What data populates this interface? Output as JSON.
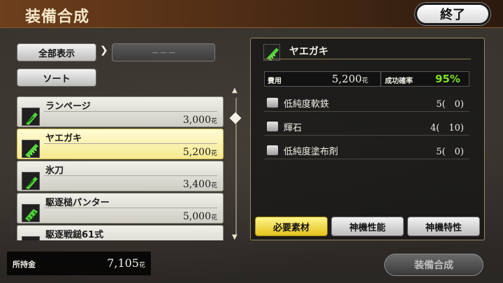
{
  "header": {
    "title": "装備合成",
    "end_label": "終了"
  },
  "controls": {
    "show_all_label": "全部表示",
    "filter_arrow": "❯",
    "filter_value": "－－－",
    "sort_label": "ソート"
  },
  "list": {
    "items": [
      {
        "name": "ランページ",
        "price": "3,000",
        "currency": "花"
      },
      {
        "name": "ヤエガキ",
        "price": "5,200",
        "currency": "花"
      },
      {
        "name": "氷刀",
        "price": "3,400",
        "currency": "花"
      },
      {
        "name": "駆逐槌パンター",
        "price": "5,000",
        "currency": "花"
      },
      {
        "name": "駆逐戦鎚61式",
        "price": "",
        "currency": ""
      }
    ]
  },
  "money": {
    "label": "所持金",
    "value": "7,105",
    "currency": "花"
  },
  "detail": {
    "name": "ヤエガキ",
    "cost_label": "費用",
    "cost_value": "5,200",
    "cost_currency": "花",
    "rate_label": "成功確率",
    "rate_value": "95%",
    "materials": [
      {
        "name": "低純度軟鉄",
        "qty": "5(　0)"
      },
      {
        "name": "輝石",
        "qty": "4(　10)"
      },
      {
        "name": "低純度塗布剤",
        "qty": "5(　0)"
      }
    ]
  },
  "tabs": {
    "required": "必要素材",
    "performance": "神機性能",
    "traits": "神機特性"
  },
  "synth_label": "装備合成",
  "colors": {
    "accent_green": "#7de31f",
    "selected_yellow": "#f6e98e",
    "header_brown": "#6e3f1c"
  }
}
